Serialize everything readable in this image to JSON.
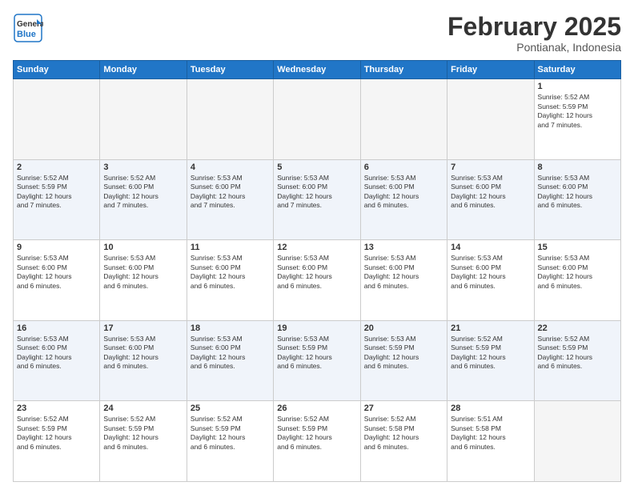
{
  "logo": {
    "line1": "General",
    "line2": "Blue"
  },
  "header": {
    "month": "February 2025",
    "location": "Pontianak, Indonesia"
  },
  "weekdays": [
    "Sunday",
    "Monday",
    "Tuesday",
    "Wednesday",
    "Thursday",
    "Friday",
    "Saturday"
  ],
  "weeks": [
    [
      {
        "day": "",
        "info": ""
      },
      {
        "day": "",
        "info": ""
      },
      {
        "day": "",
        "info": ""
      },
      {
        "day": "",
        "info": ""
      },
      {
        "day": "",
        "info": ""
      },
      {
        "day": "",
        "info": ""
      },
      {
        "day": "1",
        "info": "Sunrise: 5:52 AM\nSunset: 5:59 PM\nDaylight: 12 hours\nand 7 minutes."
      }
    ],
    [
      {
        "day": "2",
        "info": "Sunrise: 5:52 AM\nSunset: 5:59 PM\nDaylight: 12 hours\nand 7 minutes."
      },
      {
        "day": "3",
        "info": "Sunrise: 5:52 AM\nSunset: 6:00 PM\nDaylight: 12 hours\nand 7 minutes."
      },
      {
        "day": "4",
        "info": "Sunrise: 5:53 AM\nSunset: 6:00 PM\nDaylight: 12 hours\nand 7 minutes."
      },
      {
        "day": "5",
        "info": "Sunrise: 5:53 AM\nSunset: 6:00 PM\nDaylight: 12 hours\nand 7 minutes."
      },
      {
        "day": "6",
        "info": "Sunrise: 5:53 AM\nSunset: 6:00 PM\nDaylight: 12 hours\nand 6 minutes."
      },
      {
        "day": "7",
        "info": "Sunrise: 5:53 AM\nSunset: 6:00 PM\nDaylight: 12 hours\nand 6 minutes."
      },
      {
        "day": "8",
        "info": "Sunrise: 5:53 AM\nSunset: 6:00 PM\nDaylight: 12 hours\nand 6 minutes."
      }
    ],
    [
      {
        "day": "9",
        "info": "Sunrise: 5:53 AM\nSunset: 6:00 PM\nDaylight: 12 hours\nand 6 minutes."
      },
      {
        "day": "10",
        "info": "Sunrise: 5:53 AM\nSunset: 6:00 PM\nDaylight: 12 hours\nand 6 minutes."
      },
      {
        "day": "11",
        "info": "Sunrise: 5:53 AM\nSunset: 6:00 PM\nDaylight: 12 hours\nand 6 minutes."
      },
      {
        "day": "12",
        "info": "Sunrise: 5:53 AM\nSunset: 6:00 PM\nDaylight: 12 hours\nand 6 minutes."
      },
      {
        "day": "13",
        "info": "Sunrise: 5:53 AM\nSunset: 6:00 PM\nDaylight: 12 hours\nand 6 minutes."
      },
      {
        "day": "14",
        "info": "Sunrise: 5:53 AM\nSunset: 6:00 PM\nDaylight: 12 hours\nand 6 minutes."
      },
      {
        "day": "15",
        "info": "Sunrise: 5:53 AM\nSunset: 6:00 PM\nDaylight: 12 hours\nand 6 minutes."
      }
    ],
    [
      {
        "day": "16",
        "info": "Sunrise: 5:53 AM\nSunset: 6:00 PM\nDaylight: 12 hours\nand 6 minutes."
      },
      {
        "day": "17",
        "info": "Sunrise: 5:53 AM\nSunset: 6:00 PM\nDaylight: 12 hours\nand 6 minutes."
      },
      {
        "day": "18",
        "info": "Sunrise: 5:53 AM\nSunset: 6:00 PM\nDaylight: 12 hours\nand 6 minutes."
      },
      {
        "day": "19",
        "info": "Sunrise: 5:53 AM\nSunset: 5:59 PM\nDaylight: 12 hours\nand 6 minutes."
      },
      {
        "day": "20",
        "info": "Sunrise: 5:53 AM\nSunset: 5:59 PM\nDaylight: 12 hours\nand 6 minutes."
      },
      {
        "day": "21",
        "info": "Sunrise: 5:52 AM\nSunset: 5:59 PM\nDaylight: 12 hours\nand 6 minutes."
      },
      {
        "day": "22",
        "info": "Sunrise: 5:52 AM\nSunset: 5:59 PM\nDaylight: 12 hours\nand 6 minutes."
      }
    ],
    [
      {
        "day": "23",
        "info": "Sunrise: 5:52 AM\nSunset: 5:59 PM\nDaylight: 12 hours\nand 6 minutes."
      },
      {
        "day": "24",
        "info": "Sunrise: 5:52 AM\nSunset: 5:59 PM\nDaylight: 12 hours\nand 6 minutes."
      },
      {
        "day": "25",
        "info": "Sunrise: 5:52 AM\nSunset: 5:59 PM\nDaylight: 12 hours\nand 6 minutes."
      },
      {
        "day": "26",
        "info": "Sunrise: 5:52 AM\nSunset: 5:59 PM\nDaylight: 12 hours\nand 6 minutes."
      },
      {
        "day": "27",
        "info": "Sunrise: 5:52 AM\nSunset: 5:58 PM\nDaylight: 12 hours\nand 6 minutes."
      },
      {
        "day": "28",
        "info": "Sunrise: 5:51 AM\nSunset: 5:58 PM\nDaylight: 12 hours\nand 6 minutes."
      },
      {
        "day": "",
        "info": ""
      }
    ]
  ]
}
